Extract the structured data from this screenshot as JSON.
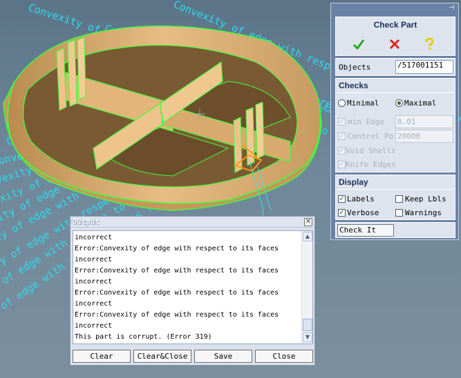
{
  "viewport": {
    "background_text": "Convexity of edge with respect to its faces incorrect",
    "colors": {
      "part_face": "#dcae74",
      "part_edge": "#3dff3d",
      "highlight": "#ff9a1a",
      "background_text": "#2fd9ee"
    }
  },
  "check_part": {
    "title": "Check Part",
    "toolbar": [
      {
        "name": "ok-icon",
        "color": "#1ea81e"
      },
      {
        "name": "cancel-icon",
        "color": "#e02020"
      },
      {
        "name": "help-icon",
        "color": "#e7cd00"
      }
    ],
    "objects": {
      "label": "Objects",
      "value": "/517001151"
    },
    "checks": {
      "title": "Checks",
      "mode_minimal": "Minimal",
      "mode_maximal": "Maximal",
      "selected_mode": "Maximal",
      "min_edge": {
        "label": "min Edge",
        "value": "0.01",
        "checked": true
      },
      "control_points": {
        "label": "Control Po:",
        "value": "20000",
        "checked": true
      },
      "void_shells": {
        "label": "Void Shells",
        "checked": true
      },
      "knife_edges": {
        "label": "Knife Edges",
        "checked": true
      }
    },
    "display": {
      "title": "Display",
      "labels": {
        "label": "Labels",
        "checked": true
      },
      "keep_lbls": {
        "label": "Keep Lbls",
        "checked": false
      },
      "verbose": {
        "label": "Verbose",
        "checked": true
      },
      "warnings": {
        "label": "Warnings",
        "checked": false
      }
    },
    "check_it": "Check It"
  },
  "output": {
    "title": "Output",
    "close_glyph": "✕",
    "lines": [
      "incorrect",
      "Error:Convexity of edge with respect to its faces",
      "incorrect",
      "Error:Convexity of edge with respect to its faces",
      "incorrect",
      "Error:Convexity of edge with respect to its faces",
      "incorrect",
      "Error:Convexity of edge with respect to its faces",
      "incorrect",
      "This part is corrupt.   (Error 319)"
    ],
    "buttons": {
      "clear": "Clear",
      "clear_close": "Clear&Close",
      "save": "Save",
      "close": "Close"
    }
  }
}
